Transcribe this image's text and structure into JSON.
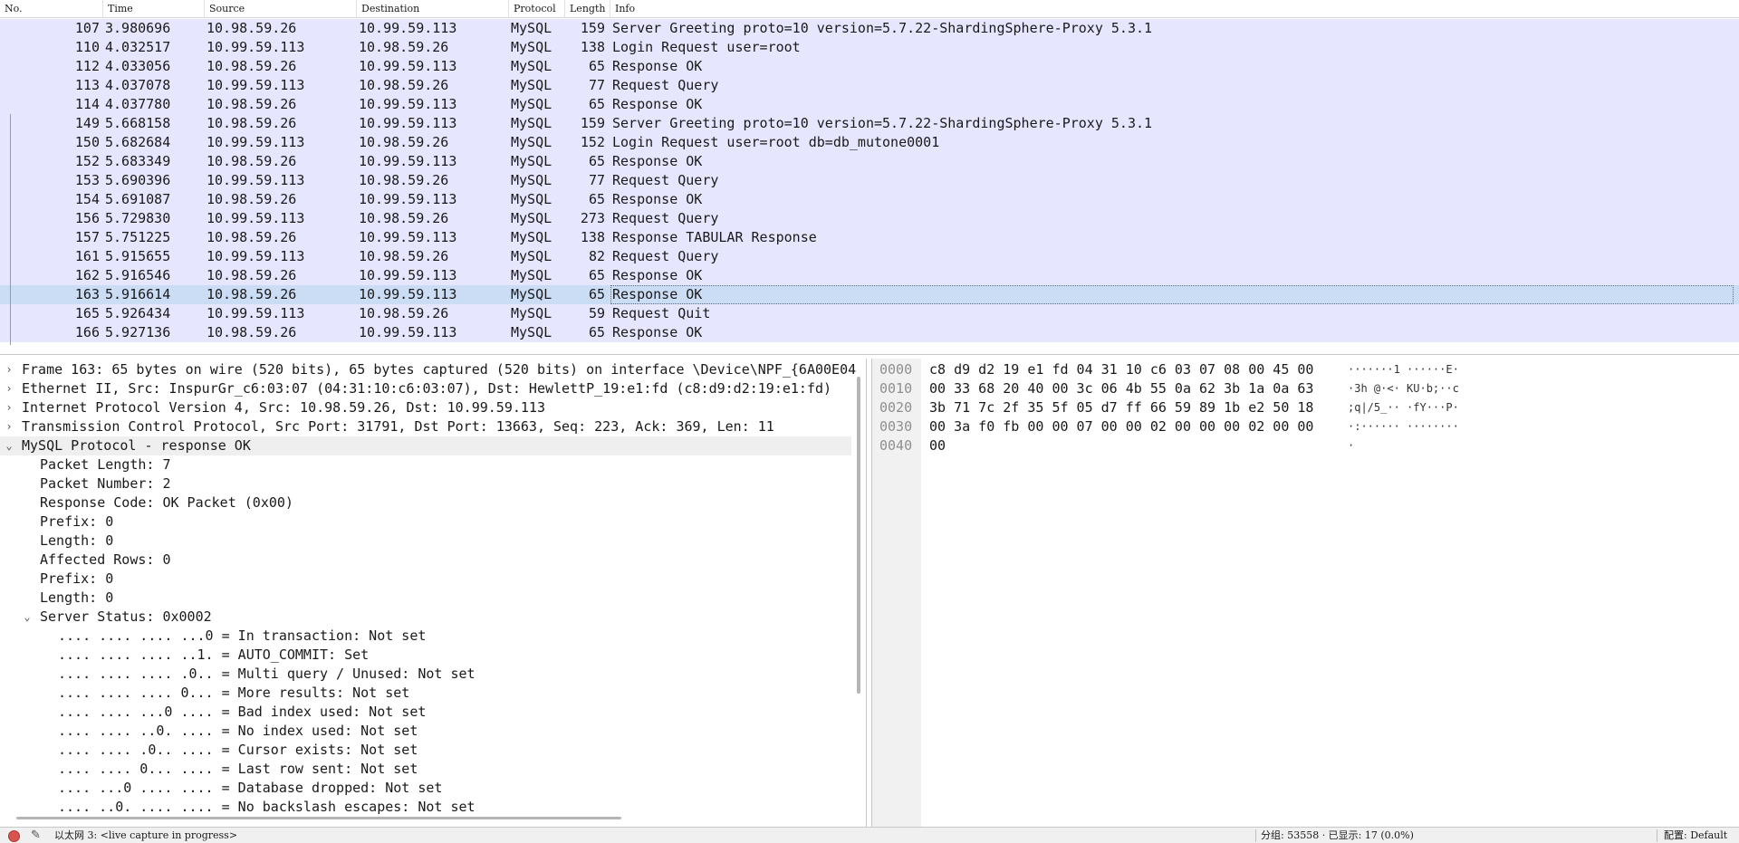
{
  "packet_list": {
    "columns": [
      "No.",
      "Time",
      "Source",
      "Destination",
      "Protocol",
      "Length",
      "Info"
    ],
    "rows": [
      {
        "no": "107",
        "time": "3.980696",
        "src": "10.98.59.26",
        "dst": "10.99.59.113",
        "proto": "MySQL",
        "len": "159",
        "info": "Server Greeting  proto=10 version=5.7.22-ShardingSphere-Proxy 5.3.1"
      },
      {
        "no": "110",
        "time": "4.032517",
        "src": "10.99.59.113",
        "dst": "10.98.59.26",
        "proto": "MySQL",
        "len": "138",
        "info": "Login Request user=root"
      },
      {
        "no": "112",
        "time": "4.033056",
        "src": "10.98.59.26",
        "dst": "10.99.59.113",
        "proto": "MySQL",
        "len": "65",
        "info": "Response  OK"
      },
      {
        "no": "113",
        "time": "4.037078",
        "src": "10.99.59.113",
        "dst": "10.98.59.26",
        "proto": "MySQL",
        "len": "77",
        "info": "Request Query"
      },
      {
        "no": "114",
        "time": "4.037780",
        "src": "10.98.59.26",
        "dst": "10.99.59.113",
        "proto": "MySQL",
        "len": "65",
        "info": "Response  OK"
      },
      {
        "no": "149",
        "time": "5.668158",
        "src": "10.98.59.26",
        "dst": "10.99.59.113",
        "proto": "MySQL",
        "len": "159",
        "info": "Server Greeting  proto=10 version=5.7.22-ShardingSphere-Proxy 5.3.1"
      },
      {
        "no": "150",
        "time": "5.682684",
        "src": "10.99.59.113",
        "dst": "10.98.59.26",
        "proto": "MySQL",
        "len": "152",
        "info": "Login Request user=root db=db_mutone0001"
      },
      {
        "no": "152",
        "time": "5.683349",
        "src": "10.98.59.26",
        "dst": "10.99.59.113",
        "proto": "MySQL",
        "len": "65",
        "info": "Response  OK"
      },
      {
        "no": "153",
        "time": "5.690396",
        "src": "10.99.59.113",
        "dst": "10.98.59.26",
        "proto": "MySQL",
        "len": "77",
        "info": "Request Query"
      },
      {
        "no": "154",
        "time": "5.691087",
        "src": "10.98.59.26",
        "dst": "10.99.59.113",
        "proto": "MySQL",
        "len": "65",
        "info": "Response  OK"
      },
      {
        "no": "156",
        "time": "5.729830",
        "src": "10.99.59.113",
        "dst": "10.98.59.26",
        "proto": "MySQL",
        "len": "273",
        "info": "Request Query"
      },
      {
        "no": "157",
        "time": "5.751225",
        "src": "10.98.59.26",
        "dst": "10.99.59.113",
        "proto": "MySQL",
        "len": "138",
        "info": "Response TABULAR Response"
      },
      {
        "no": "161",
        "time": "5.915655",
        "src": "10.99.59.113",
        "dst": "10.98.59.26",
        "proto": "MySQL",
        "len": "82",
        "info": "Request Query"
      },
      {
        "no": "162",
        "time": "5.916546",
        "src": "10.98.59.26",
        "dst": "10.99.59.113",
        "proto": "MySQL",
        "len": "65",
        "info": "Response  OK"
      },
      {
        "no": "163",
        "time": "5.916614",
        "src": "10.98.59.26",
        "dst": "10.99.59.113",
        "proto": "MySQL",
        "len": "65",
        "info": "Response  OK"
      },
      {
        "no": "165",
        "time": "5.926434",
        "src": "10.99.59.113",
        "dst": "10.98.59.26",
        "proto": "MySQL",
        "len": "59",
        "info": "Request Quit"
      },
      {
        "no": "166",
        "time": "5.927136",
        "src": "10.98.59.26",
        "dst": "10.99.59.113",
        "proto": "MySQL",
        "len": "65",
        "info": "Response  OK"
      }
    ]
  },
  "details": {
    "frame": "Frame 163: 65 bytes on wire (520 bits), 65 bytes captured (520 bits) on interface \\Device\\NPF_{6A00E04",
    "ethernet": "Ethernet II, Src: InspurGr_c6:03:07 (04:31:10:c6:03:07), Dst: HewlettP_19:e1:fd (c8:d9:d2:19:e1:fd)",
    "ip": "Internet Protocol Version 4, Src: 10.98.59.26, Dst: 10.99.59.113",
    "tcp": "Transmission Control Protocol, Src Port: 31791, Dst Port: 13663, Seq: 223, Ack: 369, Len: 11",
    "mysql": "MySQL Protocol - response OK",
    "mysql_fields": [
      "Packet Length: 7",
      "Packet Number: 2",
      "Response Code: OK Packet (0x00)",
      "Prefix: 0",
      "Length: 0",
      "Affected Rows: 0",
      "Prefix: 0",
      "Length: 0"
    ],
    "server_status": "Server Status: 0x0002",
    "status_bits": [
      ".... .... .... ...0 = In transaction: Not set",
      ".... .... .... ..1. = AUTO_COMMIT: Set",
      ".... .... .... .0.. = Multi query / Unused: Not set",
      ".... .... .... 0... = More results: Not set",
      ".... .... ...0 .... = Bad index used: Not set",
      ".... .... ..0. .... = No index used: Not set",
      ".... .... .0.. .... = Cursor exists: Not set",
      ".... .... 0... .... = Last row sent: Not set",
      ".... ...0 .... .... = Database dropped: Not set",
      ".... ..0. .... .... = No backslash escapes: Not set"
    ]
  },
  "bytes": {
    "rows": [
      {
        "offset": "0000",
        "hex": "c8 d9 d2 19 e1 fd 04 31  10 c6 03 07 08 00 45 00",
        "ascii": "·······1 ······E·"
      },
      {
        "offset": "0010",
        "hex": "00 33 68 20 40 00 3c 06  4b 55 0a 62 3b 1a 0a 63",
        "ascii": "·3h @·<· KU·b;··c"
      },
      {
        "offset": "0020",
        "hex": "3b 71 7c 2f 35 5f 05 d7  ff 66 59 89 1b e2 50 18",
        "ascii": ";q|/5_·· ·fY···P·"
      },
      {
        "offset": "0030",
        "hex": "00 3a f0 fb 00 00 07 00  00 02 00 00 00 02 00 00",
        "ascii": "·:······ ········"
      },
      {
        "offset": "0040",
        "hex": "00",
        "ascii": "·"
      }
    ]
  },
  "statusbar": {
    "edit_icon": "edit-icon",
    "interface": "以太网 3: <live capture in progress>",
    "counts": "分组: 53558 · 已显示: 17 (0.0%)",
    "profile": "配置: Default"
  },
  "colors": {
    "row_bg": "#e7e6ff",
    "row_selected": "#cbdcf5",
    "record": "#d9534f"
  }
}
